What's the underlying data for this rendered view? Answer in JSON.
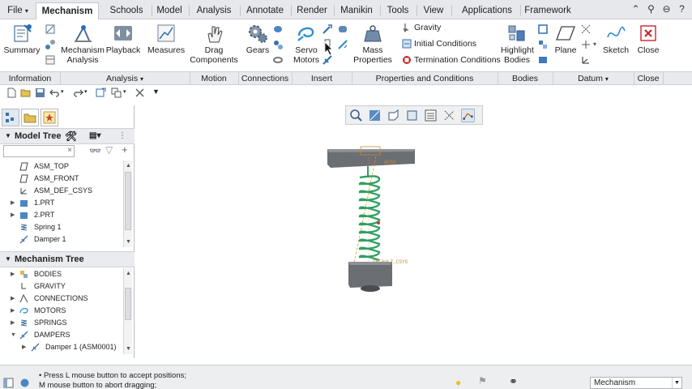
{
  "tabs": [
    {
      "label": "File",
      "dropdown": "▾"
    },
    {
      "label": "Mechanism"
    },
    {
      "label": "Schools"
    },
    {
      "label": "Model"
    },
    {
      "label": "Analysis"
    },
    {
      "label": "Annotate"
    },
    {
      "label": "Render"
    },
    {
      "label": "Manikin"
    },
    {
      "label": "Tools"
    },
    {
      "label": "View"
    },
    {
      "label": "Applications"
    },
    {
      "label": "Framework"
    }
  ],
  "ribbon": {
    "summary": "Summary",
    "mechanism_analysis_1": "Mechanism",
    "mechanism_analysis_2": "Analysis",
    "playback": "Playback",
    "measures": "Measures",
    "drag_1": "Drag",
    "drag_2": "Components",
    "gears": "Gears",
    "servo_1": "Servo",
    "servo_2": "Motors",
    "mass_1": "Mass",
    "mass_2": "Properties",
    "gravity": "Gravity",
    "initial_conditions": "Initial Conditions",
    "termination_conditions": "Termination Conditions",
    "highlight_1": "Highlight",
    "highlight_2": "Bodies",
    "plane": "Plane",
    "sketch": "Sketch",
    "close": "Close"
  },
  "groups": {
    "information": "Information",
    "analysis": "Analysis",
    "analysis_dd": "▾",
    "motion": "Motion",
    "connections": "Connections",
    "insert": "Insert",
    "properties": "Properties and Conditions",
    "bodies": "Bodies",
    "datum": "Datum",
    "datum_dd": "▾",
    "close": "Close"
  },
  "model_tree": {
    "title": "Model Tree",
    "items": [
      {
        "label": "ASM_TOP",
        "icon": "plane-icon"
      },
      {
        "label": "ASM_FRONT",
        "icon": "plane-icon"
      },
      {
        "label": "ASM_DEF_CSYS",
        "icon": "csys-icon"
      },
      {
        "label": "1.PRT",
        "icon": "part-icon"
      },
      {
        "label": "2.PRT",
        "icon": "part-icon"
      },
      {
        "label": "Spring 1",
        "icon": "spring-icon"
      },
      {
        "label": "Damper 1",
        "icon": "damper-icon"
      }
    ]
  },
  "mechanism_tree": {
    "title": "Mechanism Tree",
    "items": [
      {
        "label": "BODIES",
        "icon": "bodies-icon"
      },
      {
        "label": "GRAVITY",
        "icon": "gravity-icon"
      },
      {
        "label": "CONNECTIONS",
        "icon": "connections-icon"
      },
      {
        "label": "MOTORS",
        "icon": "motor-icon"
      },
      {
        "label": "SPRINGS",
        "icon": "spring-icon"
      },
      {
        "label": "DAMPERS",
        "icon": "damper-icon"
      },
      {
        "label": "Damper 1 (ASM0001)",
        "icon": "damper-icon"
      }
    ]
  },
  "model": {
    "csys_top": "ACS0",
    "csys_bottom": "DEFAULT_CSYS"
  },
  "status": {
    "line1": "Press L mouse button to accept positions;",
    "line2": "M mouse button to abort dragging;",
    "filter": "Mechanism"
  },
  "colors": {
    "spring": "#2fa060",
    "block": "#5c5f63",
    "accent": "#2f6fb3",
    "close_red": "#c7282e"
  }
}
